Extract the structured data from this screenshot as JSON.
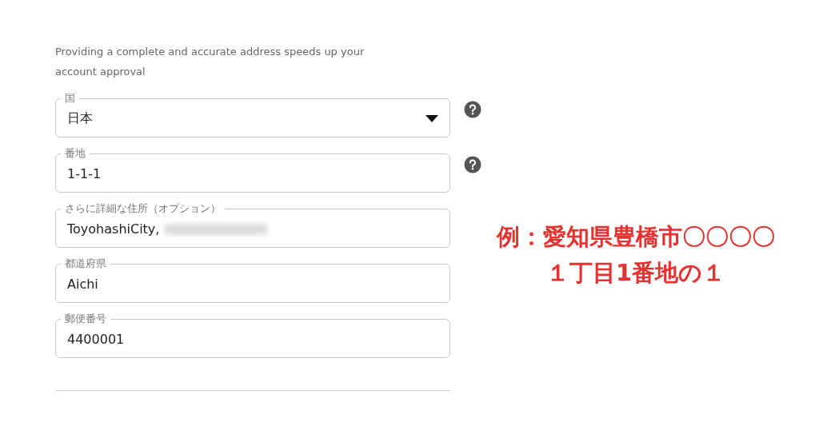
{
  "intro": "Providing a complete and accurate address speeds up your account approval",
  "fields": [
    {
      "kind": "select",
      "label": "国",
      "value": "日本",
      "help": true
    },
    {
      "kind": "text",
      "label": "番地",
      "value": "1-1-1",
      "help": true
    },
    {
      "kind": "text",
      "label": "さらに詳細な住所（オプション）",
      "value": "ToyohashiCity,",
      "help": false,
      "redacted": true
    },
    {
      "kind": "text",
      "label": "都道府県",
      "value": "Aichi",
      "help": false
    },
    {
      "kind": "text",
      "label": "郵便番号",
      "value": "4400001",
      "help": false
    }
  ],
  "annotation": [
    "例：愛知県豊橋市〇〇〇〇",
    "１丁目1番地の１"
  ]
}
